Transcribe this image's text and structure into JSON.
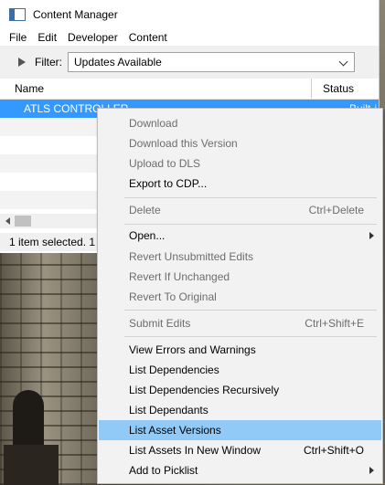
{
  "window": {
    "title": "Content Manager"
  },
  "menubar": [
    "File",
    "Edit",
    "Developer",
    "Content"
  ],
  "filter": {
    "label": "Filter:",
    "value": "Updates Available"
  },
  "table": {
    "columns": [
      "Name",
      "Status"
    ],
    "selected_row": {
      "name": "ATLS CONTROLLER",
      "status": "Built-i"
    }
  },
  "statusbar": {
    "text": "1 item selected. 1"
  },
  "context_menu": [
    {
      "label": "Download",
      "disabled": true
    },
    {
      "label": "Download this Version",
      "disabled": true
    },
    {
      "label": "Upload to DLS",
      "disabled": true
    },
    {
      "label": "Export to CDP...",
      "disabled": false
    },
    {
      "label": "Delete",
      "shortcut": "Ctrl+Delete",
      "disabled": true
    },
    {
      "label": "Open...",
      "submenu": true,
      "disabled": false
    },
    {
      "label": "Revert Unsubmitted Edits",
      "disabled": true
    },
    {
      "label": "Revert If Unchanged",
      "disabled": true
    },
    {
      "label": "Revert To Original",
      "disabled": true
    },
    {
      "label": "Submit Edits",
      "shortcut": "Ctrl+Shift+E",
      "disabled": true
    },
    {
      "label": "View Errors and Warnings",
      "disabled": false
    },
    {
      "label": "List Dependencies",
      "disabled": false
    },
    {
      "label": "List Dependencies Recursively",
      "disabled": false
    },
    {
      "label": "List Dependants",
      "disabled": false
    },
    {
      "label": "List Asset Versions",
      "disabled": false,
      "highlighted": true
    },
    {
      "label": "List Assets In New Window",
      "shortcut": "Ctrl+Shift+O",
      "disabled": false
    },
    {
      "label": "Add to Picklist",
      "submenu": true,
      "disabled": false
    }
  ]
}
